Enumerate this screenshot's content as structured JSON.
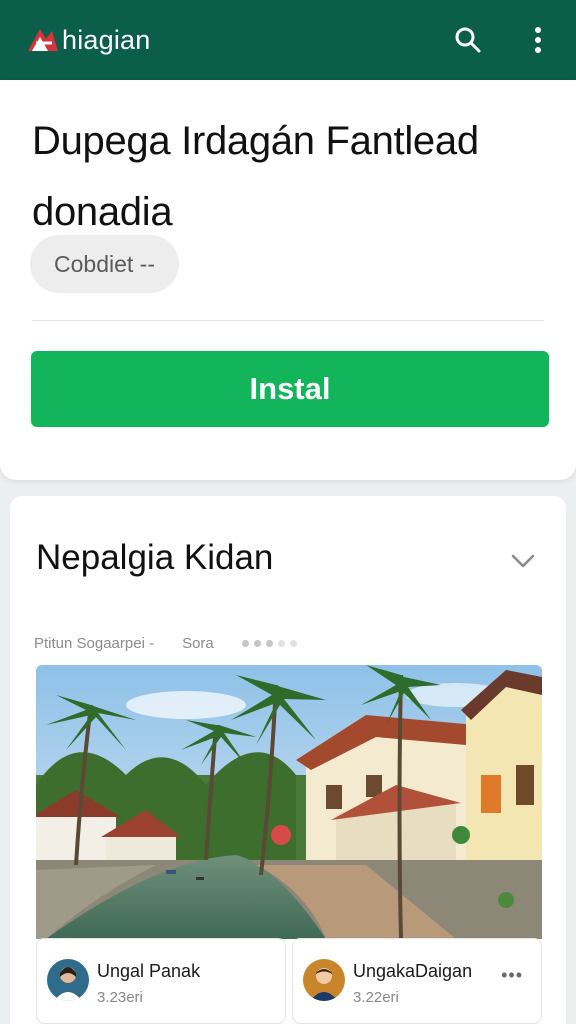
{
  "colors": {
    "header_bg": "#0b5e4a",
    "install_bg": "#13b55a",
    "logo_red": "#d6343a"
  },
  "header": {
    "brand": "hiagian",
    "logo_icon": "brand-logo-icon",
    "search_icon": "search-icon",
    "menu_icon": "more-vert-icon"
  },
  "app": {
    "title": "Dupega Irdagán Fantlead donadia",
    "chip_label": "Cobdiet --",
    "install_label": "Instal"
  },
  "section": {
    "title": "Nepalgia Kidan",
    "expand_icon": "chevron-down-icon"
  },
  "gallery": {
    "meta_left": "Ptitun Sogaarpei -",
    "meta_right": "Sora"
  },
  "reviews": [
    {
      "name": "Ungal Panak",
      "time": "3.23eri"
    },
    {
      "name": "UngakaDaigan",
      "time": "3.22eri",
      "more": "•••"
    }
  ]
}
